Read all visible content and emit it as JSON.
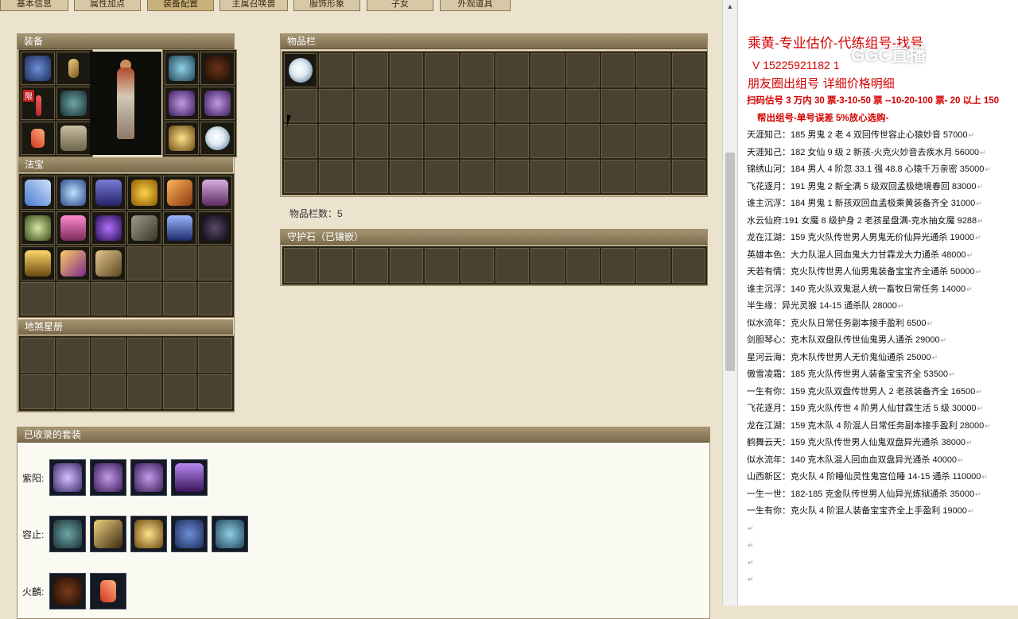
{
  "tabs": [
    "基本信息",
    "属性加点",
    "装备配置",
    "主属召唤兽",
    "服饰形象",
    "子女",
    "外观道具"
  ],
  "equip_panel": {
    "title": "装备",
    "limited_badge": "限"
  },
  "fabao_panel": {
    "title": "法宝"
  },
  "disha_panel": {
    "title": "地煞星册"
  },
  "inventory": {
    "title": "物品栏",
    "count_label": "物品栏数：5"
  },
  "guardstone": {
    "title": "守护石（已镶嵌）"
  },
  "suits": {
    "title": "已收录的套装",
    "rows": [
      {
        "name": "紫阳:",
        "icons": 4
      },
      {
        "name": "容止:",
        "icons": 5
      },
      {
        "name": "火麟:",
        "icons": 2
      }
    ]
  },
  "doc": {
    "title": "乘黄-专业估价-代练组号-找号",
    "contact": "V 15225921182   1",
    "subtitle": "朋友圈出组号    详细价格明细",
    "pricing": "扫码估号 3 万内 30 票-3-10-50 票 --10-20-100 票- 20 以上 150",
    "pricing2": "帮出组号-单号误差 5%放心选购-",
    "watermark": "GGC直播",
    "lines": [
      "天涯知己：185 男鬼 2 老 4 双回传世容止心猿妙音 57000",
      "天涯知己：182 女仙 9 级 2 新孩-火克火妙音去疾水月 56000",
      "锦绣山河：184 男人 4 阶忽 33.1 强 48.8 心猿千万亲密 35000",
      "飞花逐月：191 男鬼 2 新全满 5 级双回孟极绝境春回 83000",
      "谁主沉浮：184 男鬼 1 新孩双回血孟极乘黄装备齐全 31000",
      "水云仙府:191 女魔 8 级护身 2 老孩星盘满-克水抽女魔 9288",
      "龙在江湖：159 克火队传世男人男鬼无价仙异光通杀 19000",
      "英雄本色：大力队混人回血鬼大力甘霖龙大力通杀 48000",
      "天若有情：克火队传世男人仙男鬼装备宝宝齐全通杀 50000",
      "谁主沉浮：140 克火队双鬼混人统一畜牧日常任务 14000",
      "半生缘：异光灵猴 14-15 通杀队 28000",
      "似水流年：克火队日常任务副本接手盈利 6500",
      "剑胆琴心：克木队双盘队传世仙鬼男人通杀 29000",
      "星河云海：克木队传世男人无价鬼仙通杀 25000",
      "傲雪凌霜：185 克火队传世男人装备宝宝齐全 53500",
      "一生有你：159 克火队双盘传世男人 2 老孩装备齐全 16500",
      "飞花逐月：159 克火队传世 4 阶男人仙甘霖生活 5 级 30000",
      "龙在江湖：159 克木队 4 阶混人日常任务副本接手盈利 28000",
      "鹤舞云天：159 克火队传世男人仙鬼双盘异光通杀 38000",
      "似水流年：140 克木队混人回血血双盘异光通杀 40000",
      "山西新区：克火队 4 阶睡仙灵性鬼宫位睡 14-15 通杀 110000",
      "一生一世：182-185 克金队传世男人仙异光炼狱通杀 35000",
      "一生有你：克火队 4 阶混人装备宝宝齐全上手盈利 19000",
      "",
      "",
      "",
      ""
    ]
  }
}
